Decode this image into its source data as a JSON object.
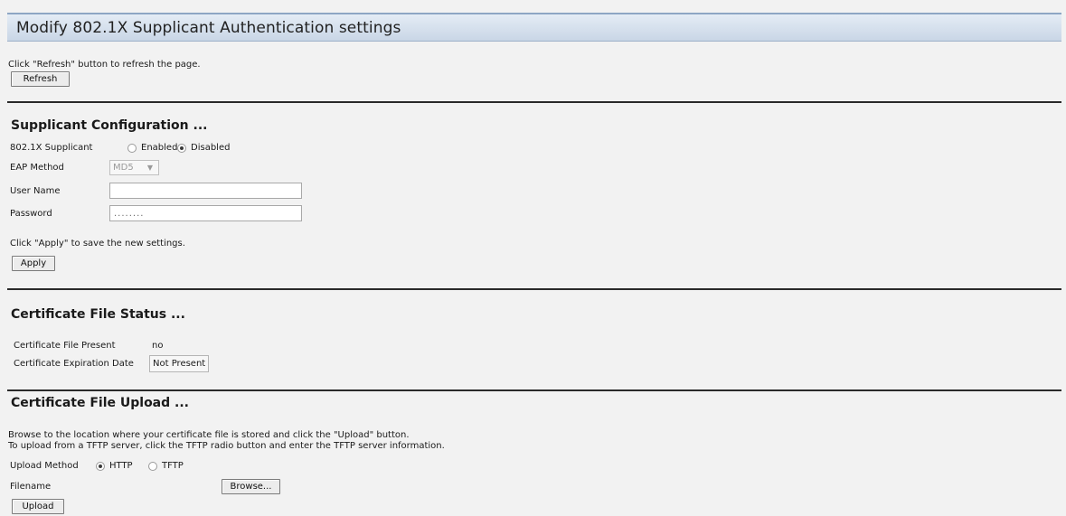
{
  "header": {
    "title": "Modify 802.1X Supplicant Authentication settings"
  },
  "refresh": {
    "instruction": "Click \"Refresh\" button to refresh the page.",
    "button_label": "Refresh"
  },
  "supplicant_config": {
    "title": "Supplicant Configuration ...",
    "supplicant_label": "802.1X Supplicant",
    "enabled_label": "Enabled",
    "disabled_label": "Disabled",
    "selected_mode": "Disabled",
    "eap_method_label": "EAP Method",
    "eap_method_value": "MD5",
    "user_name_label": "User Name",
    "user_name_value": "",
    "password_label": "Password",
    "password_value": "........",
    "apply_instruction": "Click \"Apply\" to save the new settings.",
    "apply_button": "Apply"
  },
  "certificate_status": {
    "title": "Certificate File Status ...",
    "present_label": "Certificate File Present",
    "present_value": "no",
    "expiration_label": "Certificate Expiration Date",
    "expiration_value": "Not Present"
  },
  "certificate_upload": {
    "title": "Certificate File Upload ...",
    "instruction_1": "Browse to the location where your certificate file is stored and click the \"Upload\" button.",
    "instruction_2": "To upload from a TFTP server, click the TFTP radio button and enter the TFTP server information.",
    "method_label": "Upload Method",
    "http_label": "HTTP",
    "tftp_label": "TFTP",
    "selected_method": "HTTP",
    "filename_label": "Filename",
    "browse_button": "Browse...",
    "upload_button": "Upload"
  }
}
